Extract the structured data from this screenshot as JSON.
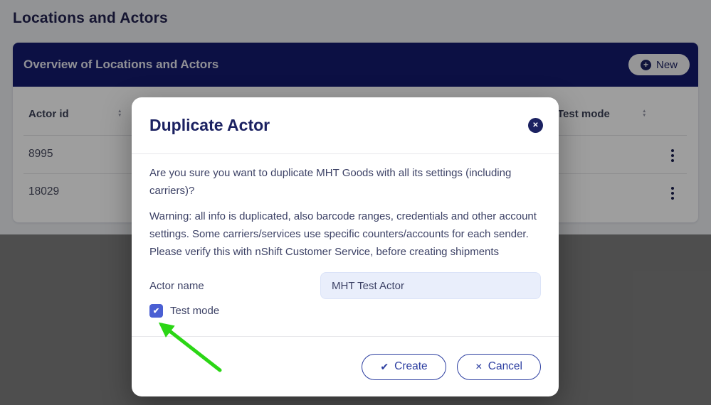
{
  "page": {
    "heading": "Locations and Actors",
    "panel": {
      "title": "Overview of Locations and Actors",
      "new_button_label": "New"
    },
    "table": {
      "columns": [
        {
          "label": "Actor id"
        },
        {
          "label": "Test mode"
        }
      ],
      "rows": [
        {
          "actor_id": "8995"
        },
        {
          "actor_id": "18029"
        }
      ]
    }
  },
  "modal": {
    "title": "Duplicate Actor",
    "confirm_text": "Are you sure you want to duplicate MHT Goods with all its settings (including carriers)?",
    "warning_text": "Warning: all info is duplicated, also barcode ranges, credentials and other account settings. Some carriers/services use specific counters/accounts for each sender. Please verify this with nShift Customer Service, before creating shipments",
    "form": {
      "actor_name_label": "Actor name",
      "actor_name_value": "MHT Test Actor",
      "test_mode_label": "Test mode",
      "test_mode_checked": true
    },
    "buttons": {
      "create_label": "Create",
      "cancel_label": "Cancel"
    }
  },
  "icons": {
    "plus": "+",
    "close_x": "✕",
    "sort_up": "▲",
    "sort_down": "▼",
    "check": "✔",
    "cancel_x": "✕"
  },
  "colors": {
    "brand_navy": "#141b6e",
    "modal_title_navy": "#1b2161",
    "action_blue": "#2b3da0",
    "checkbox_blue": "#4a5fd3",
    "input_bg": "#e9eefb",
    "arrow_green": "#2bd615",
    "overlay": "rgba(0,0,0,0.38)"
  }
}
